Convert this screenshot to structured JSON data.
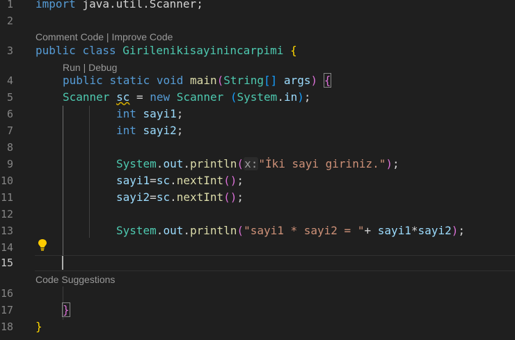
{
  "gutter": {
    "line_numbers": [
      "1",
      "2",
      "3",
      "4",
      "5",
      "6",
      "7",
      "8",
      "9",
      "10",
      "11",
      "12",
      "13",
      "14",
      "15",
      "16",
      "17",
      "18"
    ]
  },
  "codelens": {
    "class_lens": {
      "comment": "Comment Code",
      "sep": " | ",
      "improve": "Improve Code"
    },
    "main_lens": {
      "run": "Run",
      "sep": " | ",
      "debug": "Debug"
    },
    "suggestions": "Code Suggestions"
  },
  "code": {
    "l1": {
      "t1": "import",
      "t2": " java.util.Scanner;"
    },
    "l3": {
      "t1": "public",
      "t2": " ",
      "t3": "class",
      "t4": " ",
      "t5": "Girilenikisayinincarpimi",
      "t6": " ",
      "t7": "{"
    },
    "l4": {
      "t1": "public",
      "t2": " ",
      "t3": "static",
      "t4": " ",
      "t5": "void",
      "t6": " ",
      "t7": "main",
      "t8": "(",
      "t9": "String",
      "t10": "[]",
      "t11": " ",
      "t12": "args",
      "t13": ")",
      "t14": " ",
      "t15": "{"
    },
    "l5": {
      "t1": "Scanner",
      "t2": " ",
      "t3": "sc",
      "t4": " = ",
      "t5": "new",
      "t6": " ",
      "t7": "Scanner",
      "t8": " ",
      "t9": "(",
      "t10": "System",
      "t11": ".",
      "t12": "in",
      "t13": ")",
      "t14": ";"
    },
    "l6": {
      "t1": "int",
      "t2": " ",
      "t3": "sayi1",
      "t4": ";"
    },
    "l7": {
      "t1": "int",
      "t2": " ",
      "t3": "sayi2",
      "t4": ";"
    },
    "l9": {
      "t1": "System",
      "t2": ".",
      "t3": "out",
      "t4": ".",
      "t5": "println",
      "t6": "(",
      "hint": "x:",
      "t7": "\"İki sayi giriniz.\"",
      "t8": ")",
      "t9": ";"
    },
    "l10": {
      "t1": "sayi1",
      "t2": "=",
      "t3": "sc",
      "t4": ".",
      "t5": "nextInt",
      "t6": "()",
      "t7": ";"
    },
    "l11": {
      "t1": "sayi2",
      "t2": "=",
      "t3": "sc",
      "t4": ".",
      "t5": "nextInt",
      "t6": "()",
      "t7": ";"
    },
    "l13": {
      "t1": "System",
      "t2": ".",
      "t3": "out",
      "t4": ".",
      "t5": "println",
      "t6": "(",
      "t7": "\"sayi1 * sayi2 = \"",
      "t8": "+ ",
      "t9": "sayi1",
      "t10": "*",
      "t11": "sayi2",
      "t12": ")",
      "t13": ";"
    },
    "l17": {
      "t1": "}"
    },
    "l18": {
      "t1": "}"
    }
  },
  "icons": {
    "lightbulb": "lightbulb-icon"
  },
  "colors": {
    "background": "#1f1f1f",
    "keyword": "#569cd6",
    "control_keyword": "#c586c0",
    "type": "#4ec9b0",
    "function": "#dcdcaa",
    "variable": "#9cdcfe",
    "string": "#ce9178",
    "bracket_level1": "#ffd700",
    "bracket_level2": "#da70d6",
    "bracket_level3": "#179fff",
    "lightbulb": "#ffcc00"
  }
}
